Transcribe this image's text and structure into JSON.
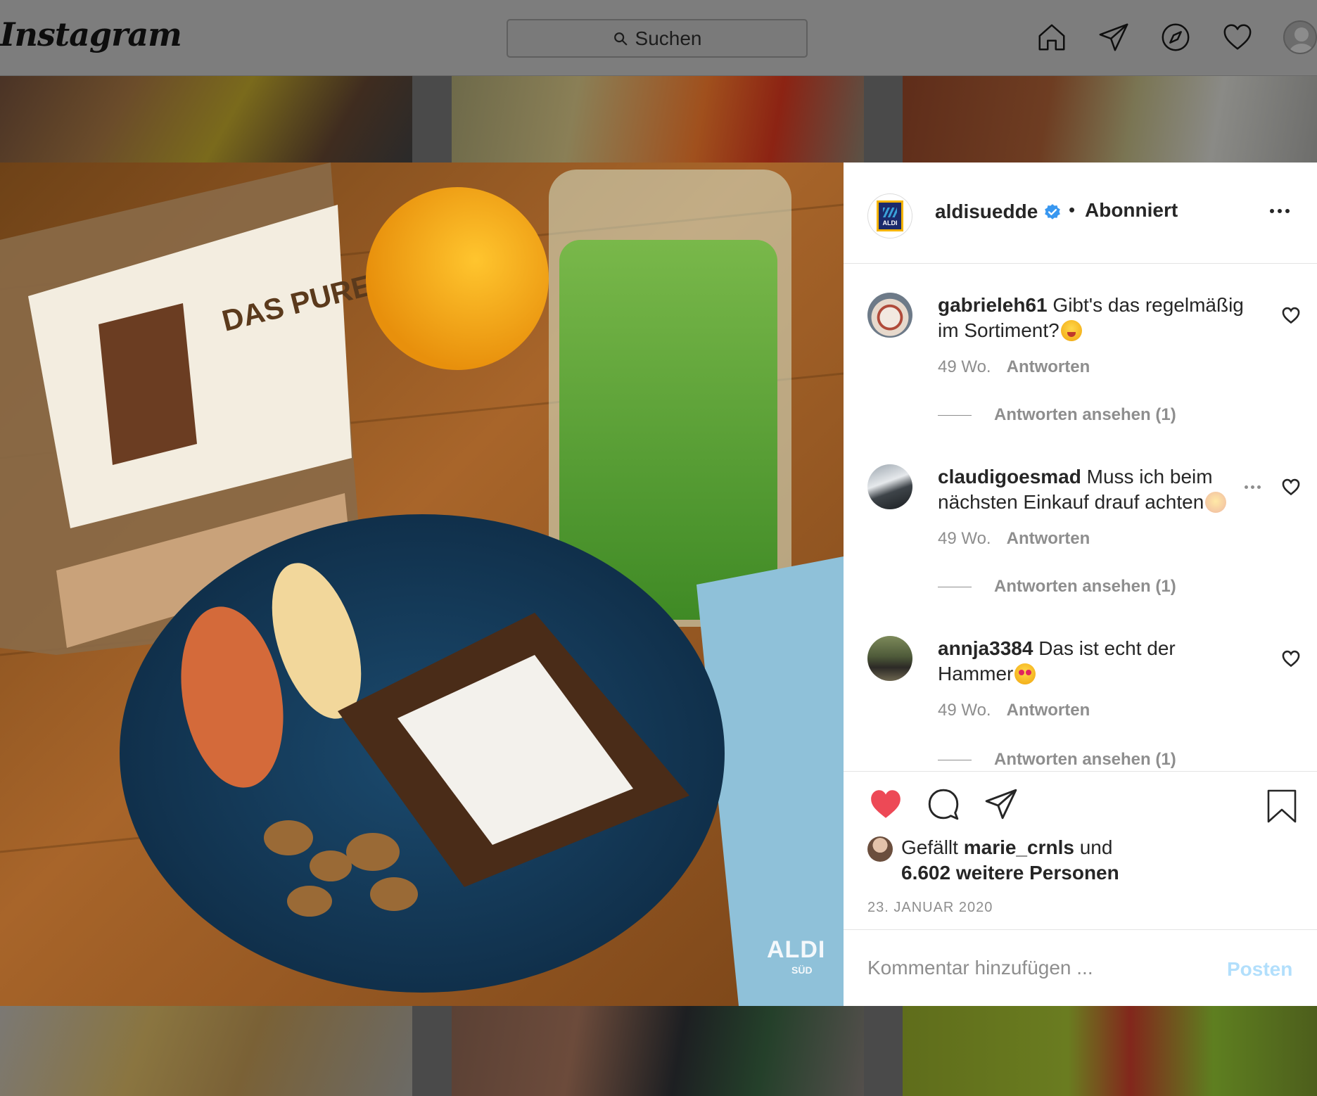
{
  "navbar": {
    "logo": "Instagram",
    "search_placeholder": "Suchen",
    "icons": [
      "home-icon",
      "direct-icon",
      "explore-icon",
      "activity-icon",
      "profile-avatar"
    ]
  },
  "post": {
    "watermark": "ALDI",
    "watermark_sub": "SÜD",
    "author": {
      "username": "aldisuedde",
      "verified": true,
      "separator": "•",
      "follow_status": "Abonniert"
    },
    "comments": [
      {
        "username": "gabrieleh61",
        "text": "Gibt's das regelmäßig im Sortiment?",
        "emoji": "yum",
        "age": "49 Wo.",
        "reply_label": "Antworten",
        "view_replies": "Antworten ansehen (1)"
      },
      {
        "username": "claudigoesmad",
        "text": "Muss ich beim nächsten Einkauf drauf achten",
        "emoji": "smile",
        "age": "49 Wo.",
        "reply_label": "Antworten",
        "view_replies": "Antworten ansehen (1)"
      },
      {
        "username": "annja3384",
        "text": "Das ist echt der Hammer",
        "emoji": "heart-eyes",
        "age": "49 Wo.",
        "reply_label": "Antworten",
        "view_replies": "Antworten ansehen (1)"
      }
    ],
    "actions": {
      "liked": true,
      "icons": [
        "heart-icon",
        "comment-icon",
        "share-icon",
        "bookmark-icon"
      ]
    },
    "likes": {
      "prefix": "Gefällt",
      "first_user": "marie_crnls",
      "connector": "und",
      "others": "6.602 weitere Personen"
    },
    "date": "23. JANUAR 2020",
    "add_comment": {
      "placeholder": "Kommentar hinzufügen ...",
      "post_label": "Posten"
    }
  },
  "colors": {
    "like_red": "#ed4956",
    "verified_blue": "#3897f0",
    "post_disabled": "#b2dffc",
    "text_primary": "#262626",
    "text_secondary": "#8e8e8e"
  }
}
